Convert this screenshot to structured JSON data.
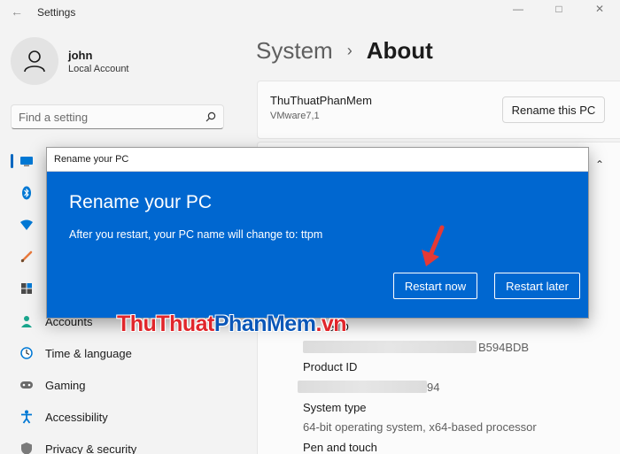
{
  "window": {
    "title": "Settings"
  },
  "profile": {
    "name": "john",
    "account_type": "Local Account"
  },
  "search": {
    "placeholder": "Find a setting"
  },
  "sidebar": {
    "items": [
      {
        "label": "",
        "icon": "system-icon"
      },
      {
        "label": "",
        "icon": "bluetooth-icon"
      },
      {
        "label": "",
        "icon": "network-icon"
      },
      {
        "label": "",
        "icon": "personalization-icon"
      },
      {
        "label": "",
        "icon": "apps-icon"
      },
      {
        "label": "Accounts",
        "icon": "accounts-icon"
      },
      {
        "label": "Time & language",
        "icon": "time-language-icon"
      },
      {
        "label": "Gaming",
        "icon": "gaming-icon"
      },
      {
        "label": "Accessibility",
        "icon": "accessibility-icon"
      },
      {
        "label": "Privacy & security",
        "icon": "privacy-icon"
      }
    ]
  },
  "breadcrumb": {
    "parent": "System",
    "separator": "›",
    "current": "About"
  },
  "pc_card": {
    "name": "ThuThuatPhanMem",
    "model": "VMware7,1",
    "rename_button": "Rename this PC"
  },
  "specs": {
    "device_id_label_fragment": "e ID",
    "device_id_value_fragment": "B594BDB",
    "product_id_label": "Product ID",
    "product_id_value_fragment": "94",
    "system_type_label": "System type",
    "system_type_value": "64-bit operating system, x64-based processor",
    "pen_touch_label": "Pen and touch"
  },
  "dialog": {
    "window_title": "Rename your PC",
    "heading": "Rename your PC",
    "message": "After you restart, your PC name will change to: ttpm",
    "restart_now": "Restart now",
    "restart_later": "Restart later"
  },
  "watermark": {
    "part1": "ThuThuat",
    "part2": "PhanMem",
    "part3": ".vn"
  },
  "colors": {
    "accent": "#0067c0",
    "dialog_bg": "#0067d0",
    "arrow": "#e53935"
  }
}
